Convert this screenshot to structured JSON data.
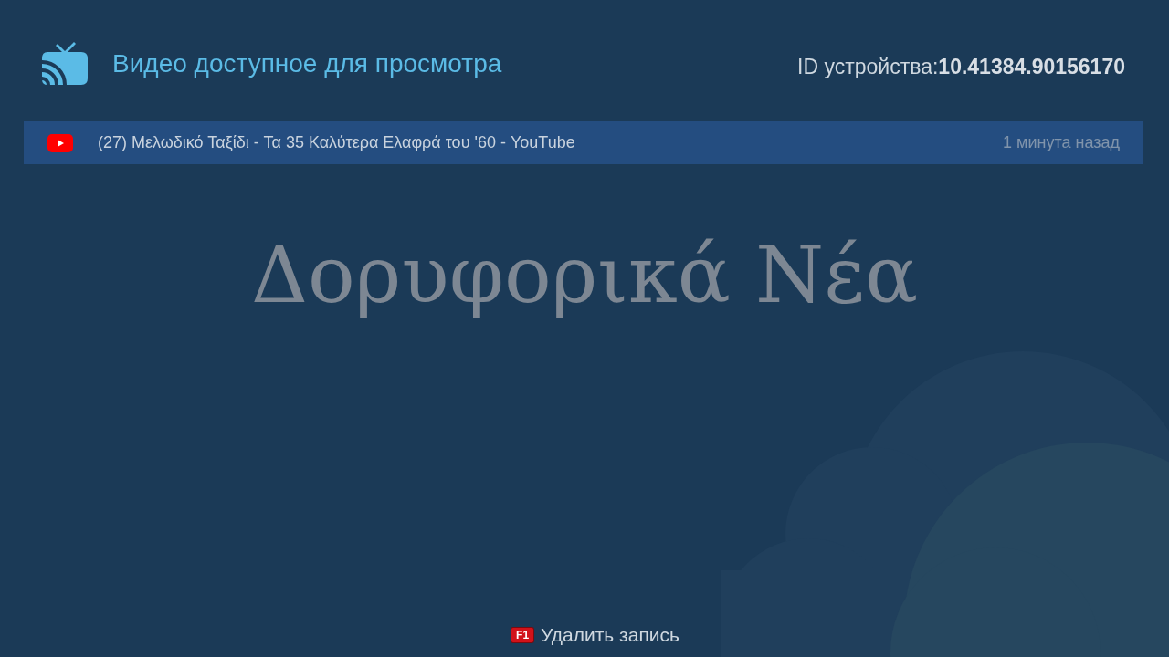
{
  "header": {
    "title": "Видео доступное для просмотра",
    "device_id_label": "ID устройства:",
    "device_id": "10.41384.90156170"
  },
  "videos": [
    {
      "kind": "youtube",
      "title": "(27) Μελωδικό Ταξίδι - Τα 35 Καλύτερα Ελαφρά του '60 - YouTube",
      "time": "1 минута назад",
      "selected": true
    }
  ],
  "channel_name": "Δορυφορικά Νέα",
  "footer": {
    "key": "F1",
    "action": "Удалить запись"
  }
}
